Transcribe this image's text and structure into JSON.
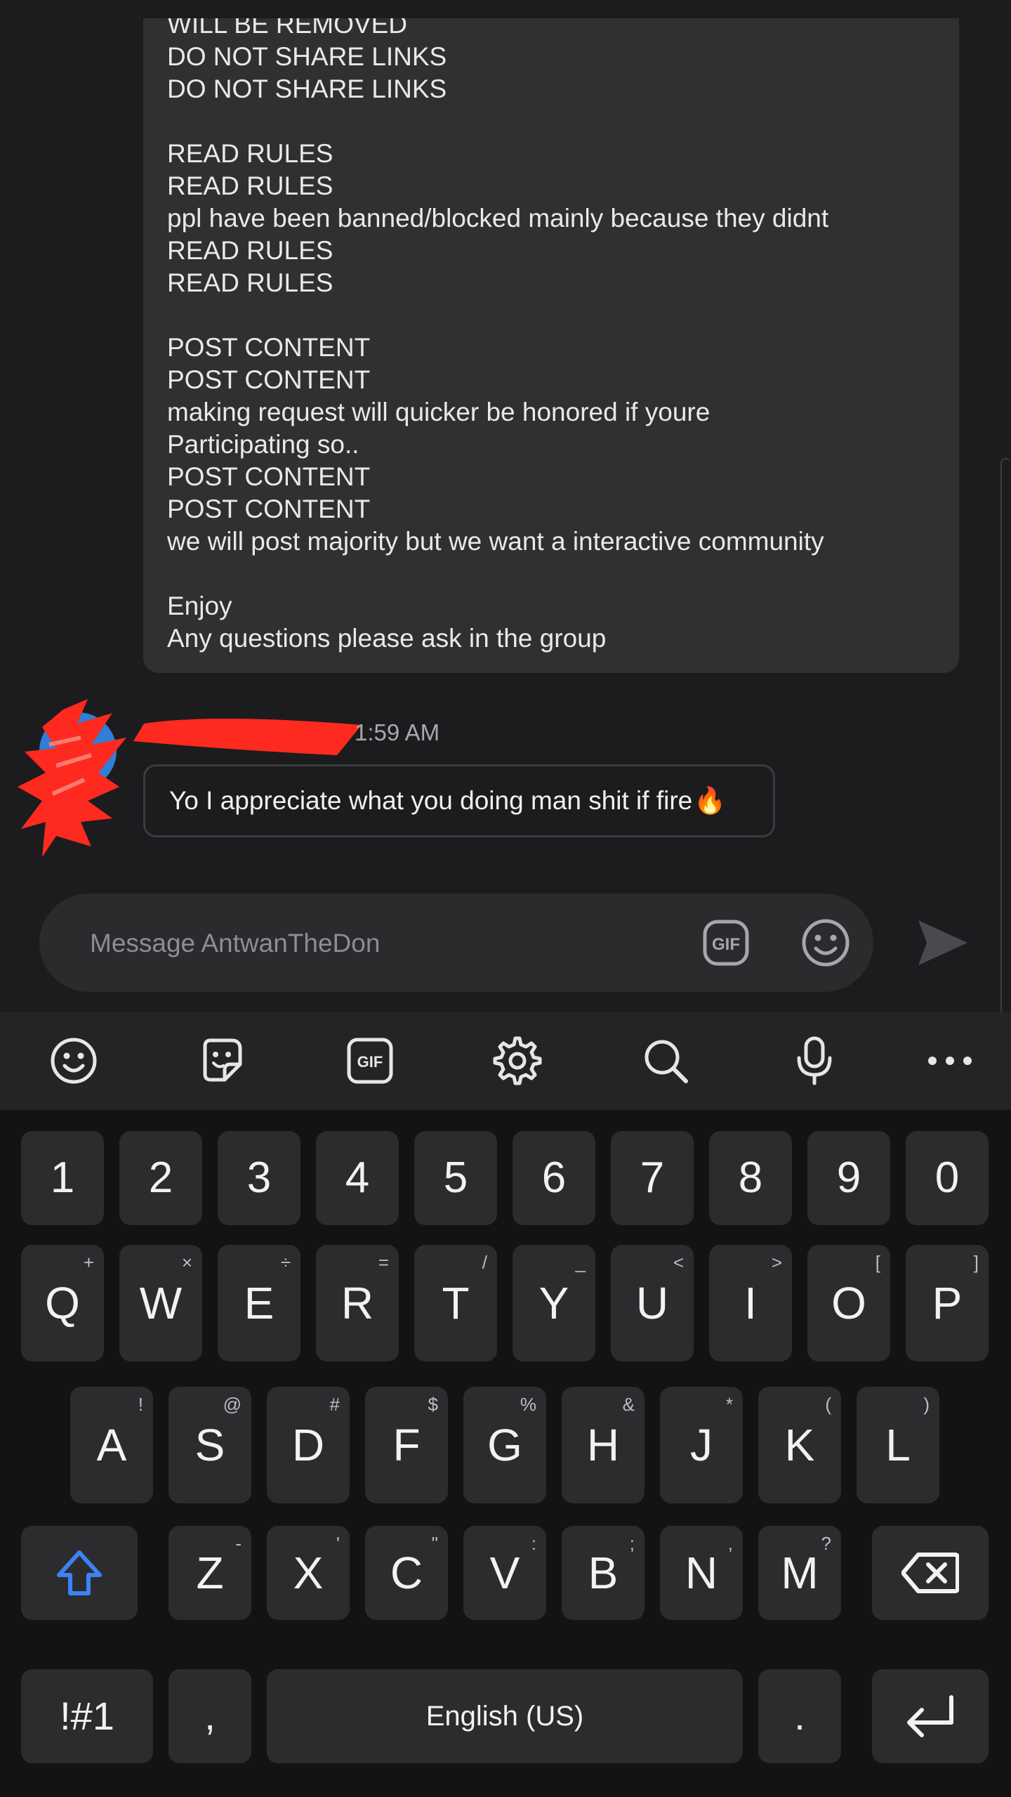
{
  "message": {
    "lines": [
      "WILL BE REMOVED",
      "DO NOT SHARE LINKS",
      "DO NOT SHARE LINKS",
      "",
      "READ RULES",
      "READ RULES",
      "ppl have been banned/blocked mainly because they didnt",
      "READ RULES",
      "READ RULES",
      "",
      "POST CONTENT",
      "POST CONTENT",
      "making request will quicker be honored if youre",
      "Participating so..",
      "POST CONTENT",
      "POST CONTENT",
      "we will post majority but we want a interactive community",
      "",
      "Enjoy",
      "Any questions please ask in the group"
    ]
  },
  "reply": {
    "timestamp": "1:59 AM",
    "text": "Yo I appreciate what you doing man shit if fire",
    "emoji": "🔥"
  },
  "composer": {
    "placeholder": "Message AntwanTheDon",
    "gif_label": "GIF"
  },
  "keyboard_toolbar": {
    "icons": [
      "emoji-icon",
      "sticker-icon",
      "gif-icon",
      "settings-icon",
      "search-icon",
      "microphone-icon",
      "more-icon"
    ],
    "gif_label": "GIF"
  },
  "keyboard": {
    "number_row": [
      "1",
      "2",
      "3",
      "4",
      "5",
      "6",
      "7",
      "8",
      "9",
      "0"
    ],
    "row1": [
      {
        "key": "Q",
        "alt": "+"
      },
      {
        "key": "W",
        "alt": "×"
      },
      {
        "key": "E",
        "alt": "÷"
      },
      {
        "key": "R",
        "alt": "="
      },
      {
        "key": "T",
        "alt": "/"
      },
      {
        "key": "Y",
        "alt": "_"
      },
      {
        "key": "U",
        "alt": "<"
      },
      {
        "key": "I",
        "alt": ">"
      },
      {
        "key": "O",
        "alt": "["
      },
      {
        "key": "P",
        "alt": "]"
      }
    ],
    "row2": [
      {
        "key": "A",
        "alt": "!"
      },
      {
        "key": "S",
        "alt": "@"
      },
      {
        "key": "D",
        "alt": "#"
      },
      {
        "key": "F",
        "alt": "$"
      },
      {
        "key": "G",
        "alt": "%"
      },
      {
        "key": "H",
        "alt": "&"
      },
      {
        "key": "J",
        "alt": "*"
      },
      {
        "key": "K",
        "alt": "("
      },
      {
        "key": "L",
        "alt": ")"
      }
    ],
    "row3": [
      {
        "key": "Z",
        "alt": "-"
      },
      {
        "key": "X",
        "alt": "'"
      },
      {
        "key": "C",
        "alt": "\""
      },
      {
        "key": "V",
        "alt": ":"
      },
      {
        "key": "B",
        "alt": ";"
      },
      {
        "key": "N",
        "alt": ","
      },
      {
        "key": "M",
        "alt": "?"
      }
    ],
    "symbols_label": "!#1",
    "comma": ",",
    "space_label": "English (US)",
    "period": ".",
    "accent_color": "#3b82f6"
  }
}
